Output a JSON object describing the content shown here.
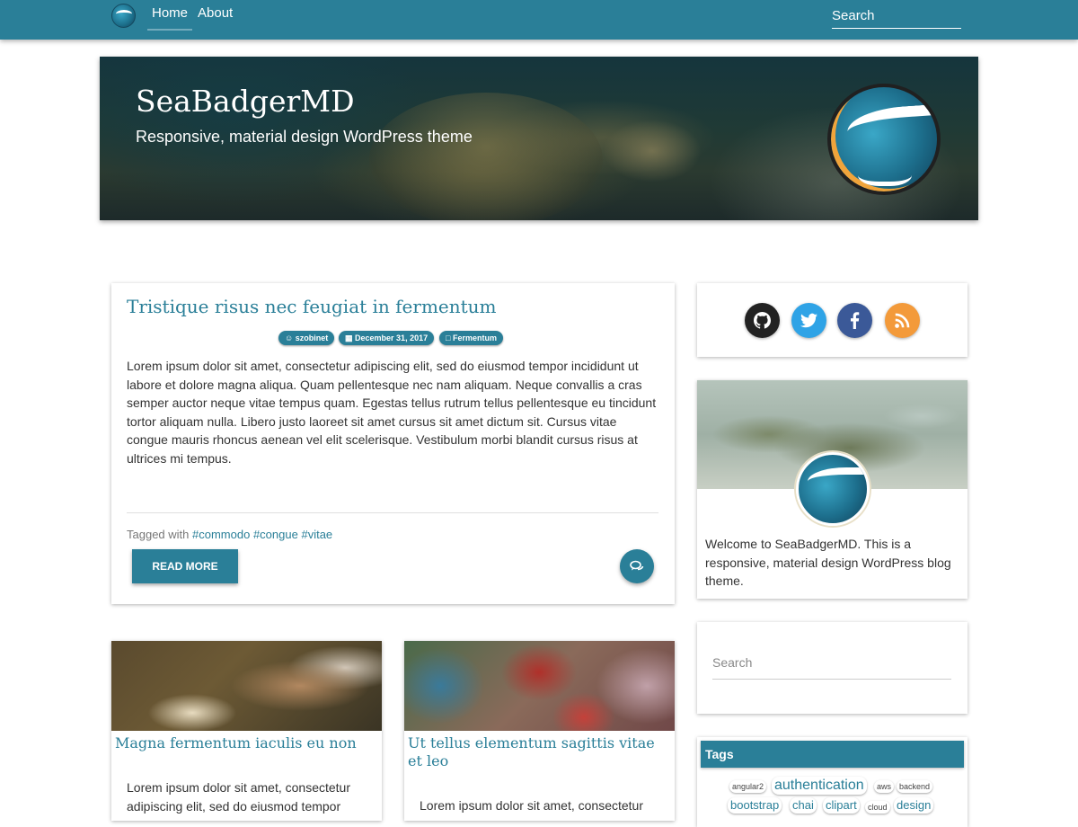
{
  "nav": {
    "logo_icon": "seabadger-logo-icon",
    "links": [
      "Home",
      "About"
    ],
    "search_placeholder": "Search"
  },
  "header": {
    "title": "SeaBadgerMD",
    "subtitle": "Responsive, material design WordPress theme",
    "logo_icon": "seabadger-logo-icon"
  },
  "featured_post": {
    "title": "Tristique risus nec feugiat in fermentum",
    "meta": {
      "author": "szobinet",
      "author_icon": "user-circle-icon",
      "date": "December 31, 2017",
      "date_icon": "calendar-icon",
      "category": "Fermentum",
      "category_icon": "folder-icon"
    },
    "excerpt": "Lorem ipsum dolor sit amet, consectetur adipiscing elit, sed do eiusmod tempor incididunt ut labore et dolore magna aliqua. Quam pellentesque nec nam aliquam. Neque convallis a cras semper auctor neque vitae tempus quam. Egestas tellus rutrum tellus pellentesque eu tincidunt tortor aliquam nulla. Libero justo laoreet sit amet cursus sit amet dictum sit. Cursus vitae congue mauris rhoncus aenean vel elit scelerisque. Vestibulum morbi blandit cursus risus at ultrices mi tempus.",
    "tagged_prefix": "Tagged with",
    "tags": [
      "#commodo",
      "#congue",
      "#vitae"
    ],
    "read_more_label": "READ MORE",
    "comment_icon": "comments-icon"
  },
  "posts": [
    {
      "title": "Magna fermentum iaculis eu non",
      "excerpt": "Lorem ipsum dolor sit amet, consectetur adipiscing elit, sed do eiusmod tempor"
    },
    {
      "title": "Ut tellus elementum sagittis vitae et leo",
      "excerpt": "Lorem ipsum dolor sit amet, consectetur"
    }
  ],
  "sidebar": {
    "social": [
      {
        "name": "github",
        "icon": "github-icon",
        "color": "#222222"
      },
      {
        "name": "twitter",
        "icon": "twitter-icon",
        "color": "#2fa3e6"
      },
      {
        "name": "facebook",
        "icon": "facebook-icon",
        "color": "#3b5998"
      },
      {
        "name": "rss",
        "icon": "rss-icon",
        "color": "#f39a3a"
      }
    ],
    "about_text": "Welcome to SeaBadgerMD. This is a responsive, material design WordPress blog theme.",
    "search_placeholder": "Search",
    "tags_title": "Tags",
    "tags": [
      "angular2",
      "authentication",
      "aws",
      "backend",
      "bootstrap",
      "chai",
      "clipart",
      "cloud",
      "design"
    ]
  },
  "colors": {
    "primary": "#2a7f98",
    "text": "#333333",
    "background": "#ffffff"
  }
}
